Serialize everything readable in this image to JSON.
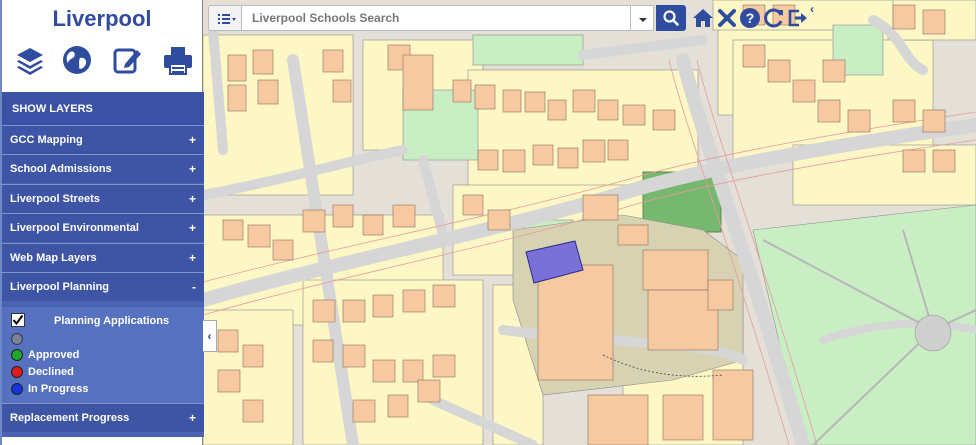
{
  "app": {
    "title": "Liverpool"
  },
  "tools": {
    "layers": "layers-icon",
    "globe": "globe-icon",
    "edit": "edit-icon",
    "print": "print-icon"
  },
  "panel": {
    "header": "SHOW LAYERS",
    "groups": [
      {
        "label": "GCC Mapping",
        "sign": "+"
      },
      {
        "label": "School Admissions",
        "sign": "+"
      },
      {
        "label": "Liverpool Streets",
        "sign": "+"
      },
      {
        "label": "Liverpool Environmental",
        "sign": "+"
      },
      {
        "label": "Web Map Layers",
        "sign": "+"
      },
      {
        "label": "Liverpool Planning",
        "sign": "-"
      },
      {
        "label": "Replacement Progress",
        "sign": "+"
      }
    ],
    "planning": {
      "layer_label": "Planning Applications",
      "checked": true,
      "legend": [
        {
          "label": "",
          "color": "#8c8c8c"
        },
        {
          "label": "Approved",
          "color": "#1fa82c"
        },
        {
          "label": "Declined",
          "color": "#e01b1b"
        },
        {
          "label": "In Progress",
          "color": "#1233e0"
        }
      ]
    }
  },
  "search": {
    "placeholder": "Liverpool Schools Search"
  },
  "toolbar": [
    "home-icon",
    "close-icon",
    "help-icon",
    "refresh-icon",
    "logout-icon"
  ],
  "colors": {
    "brand": "#2f4c9e",
    "panel": "#4a62b1",
    "building": "#f6caa0",
    "garden": "#fcf7c4",
    "green": "#c7efc2",
    "road": "#d9d9d9"
  }
}
